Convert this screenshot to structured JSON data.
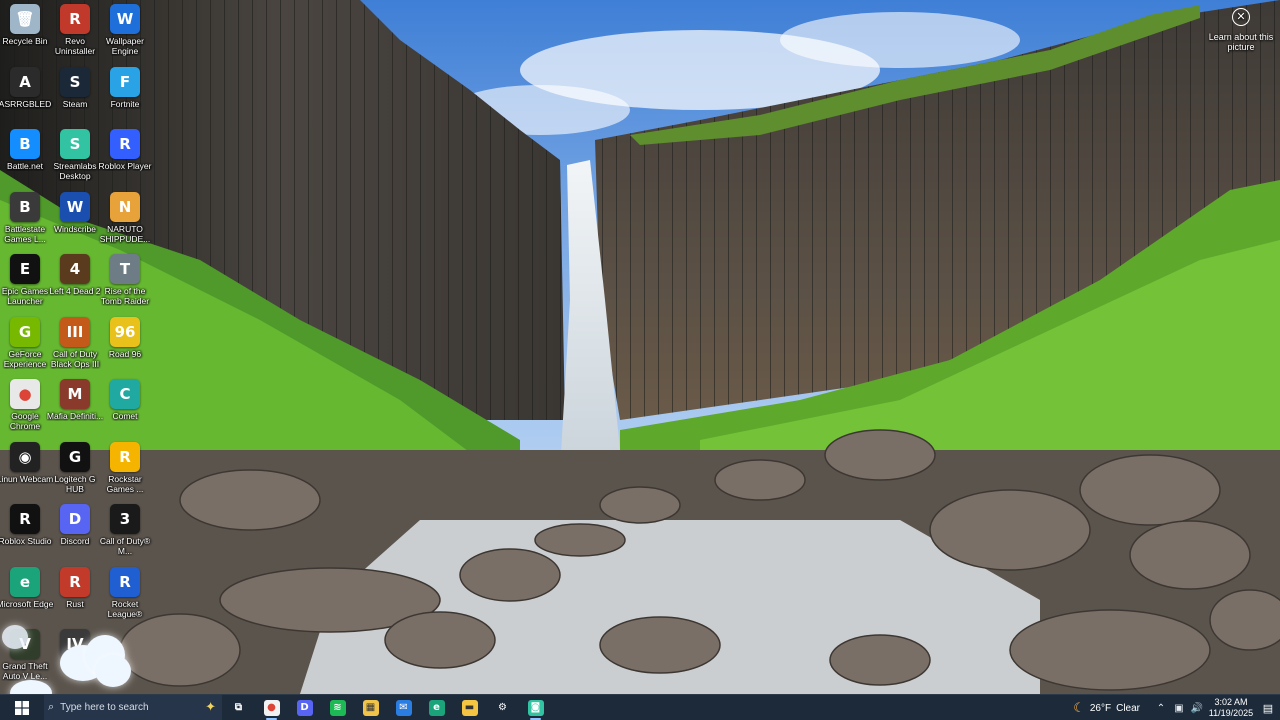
{
  "desktop": {
    "learn_label": "Learn about this picture",
    "icons": [
      {
        "label": "Recycle Bin",
        "icon": "recycle-bin-icon",
        "glyph": "🗑",
        "bg": "#9fb6c8"
      },
      {
        "label": "Revo Uninstaller",
        "icon": "revo-uninstaller-icon",
        "glyph": "R",
        "bg": "#c0392b"
      },
      {
        "label": "Wallpaper Engine",
        "icon": "wallpaper-engine-icon",
        "glyph": "W",
        "bg": "#1e6fd9"
      },
      {
        "label": "ASRRGBLED",
        "icon": "asrock-rgb-icon",
        "glyph": "A",
        "bg": "#2b2b2b"
      },
      {
        "label": "Steam",
        "icon": "steam-icon",
        "glyph": "S",
        "bg": "#1b2838"
      },
      {
        "label": "Fortnite",
        "icon": "fortnite-icon",
        "glyph": "F",
        "bg": "#2aa3e6"
      },
      {
        "label": "Battle.net",
        "icon": "battlenet-icon",
        "glyph": "B",
        "bg": "#148eff"
      },
      {
        "label": "Streamlabs Desktop",
        "icon": "streamlabs-icon",
        "glyph": "S",
        "bg": "#31c3a2"
      },
      {
        "label": "Roblox Player",
        "icon": "roblox-player-icon",
        "glyph": "R",
        "bg": "#335fff"
      },
      {
        "label": "Battlestate Games L...",
        "icon": "battlestate-icon",
        "glyph": "B",
        "bg": "#3a3a3a"
      },
      {
        "label": "Windscribe",
        "icon": "windscribe-icon",
        "glyph": "W",
        "bg": "#1a4fb0"
      },
      {
        "label": "NARUTO SHIPPUDE...",
        "icon": "naruto-icon",
        "glyph": "N",
        "bg": "#e8a23a"
      },
      {
        "label": "Epic Games Launcher",
        "icon": "epic-games-icon",
        "glyph": "E",
        "bg": "#111111"
      },
      {
        "label": "Left 4 Dead 2",
        "icon": "left4dead2-icon",
        "glyph": "4",
        "bg": "#5a3b1e"
      },
      {
        "label": "Rise of the Tomb Raider",
        "icon": "tomb-raider-icon",
        "glyph": "T",
        "bg": "#6e7c86"
      },
      {
        "label": "GeForce Experience",
        "icon": "geforce-icon",
        "glyph": "G",
        "bg": "#76b900"
      },
      {
        "label": "Call of Duty Black Ops III",
        "icon": "cod-bo3-icon",
        "glyph": "III",
        "bg": "#c45a1a"
      },
      {
        "label": "Road 96",
        "icon": "road96-icon",
        "glyph": "96",
        "bg": "#e8c21a"
      },
      {
        "label": "Google Chrome",
        "icon": "chrome-icon",
        "glyph": "●",
        "bg": "#e8e8e8"
      },
      {
        "label": "Mafia Definiti...",
        "icon": "mafia-icon",
        "glyph": "M",
        "bg": "#8a3a2a"
      },
      {
        "label": "Comet",
        "icon": "comet-icon",
        "glyph": "C",
        "bg": "#1fa9a0"
      },
      {
        "label": "Linun Webcam",
        "icon": "webcam-icon",
        "glyph": "◉",
        "bg": "#222222"
      },
      {
        "label": "Logitech G HUB",
        "icon": "logitech-ghub-icon",
        "glyph": "G",
        "bg": "#111111"
      },
      {
        "label": "Rockstar Games ...",
        "icon": "rockstar-icon",
        "glyph": "R",
        "bg": "#f5b400"
      },
      {
        "label": "Roblox Studio",
        "icon": "roblox-studio-icon",
        "glyph": "R",
        "bg": "#111111"
      },
      {
        "label": "Discord",
        "icon": "discord-icon",
        "glyph": "D",
        "bg": "#5865f2"
      },
      {
        "label": "Call of Duty® M...",
        "icon": "cod-mw-icon",
        "glyph": "3",
        "bg": "#1a1a1a"
      },
      {
        "label": "Microsoft Edge",
        "icon": "edge-icon",
        "glyph": "e",
        "bg": "#1ba37a"
      },
      {
        "label": "Rust",
        "icon": "rust-icon",
        "glyph": "R",
        "bg": "#c13a2a"
      },
      {
        "label": "Rocket League®",
        "icon": "rocket-league-icon",
        "glyph": "R",
        "bg": "#1f5fd1"
      },
      {
        "label": "Grand Theft Auto V Le...",
        "icon": "gta5-icon",
        "glyph": "V",
        "bg": "#2f3d2a"
      },
      {
        "label": "",
        "icon": "gta4-icon",
        "glyph": "IV",
        "bg": "#3a3a3a"
      }
    ]
  },
  "taskbar": {
    "search_placeholder": "Type here to search",
    "apps": [
      {
        "name": "task-view",
        "icon": "task-view-icon",
        "glyph": "⧉",
        "bg": "transparent",
        "active": false
      },
      {
        "name": "chrome",
        "icon": "chrome-icon",
        "glyph": "●",
        "bg": "#f2f2f2",
        "active": true
      },
      {
        "name": "discord",
        "icon": "discord-icon",
        "glyph": "D",
        "bg": "#5865f2",
        "active": false
      },
      {
        "name": "spotify",
        "icon": "spotify-icon",
        "glyph": "≋",
        "bg": "#1db954",
        "active": false
      },
      {
        "name": "store",
        "icon": "microsoft-store-icon",
        "glyph": "▦",
        "bg": "#f0c44a",
        "active": false
      },
      {
        "name": "mail",
        "icon": "mail-icon",
        "glyph": "✉",
        "bg": "#2a7de1",
        "active": false
      },
      {
        "name": "edge",
        "icon": "edge-icon",
        "glyph": "e",
        "bg": "#1ba37a",
        "active": false
      },
      {
        "name": "file-explorer",
        "icon": "folder-icon",
        "glyph": "▬",
        "bg": "#f4c542",
        "active": false
      },
      {
        "name": "settings",
        "icon": "gear-icon",
        "glyph": "⚙",
        "bg": "transparent",
        "active": false
      },
      {
        "name": "streamlabs",
        "icon": "streamlabs-icon",
        "glyph": "◙",
        "bg": "#31c3a2",
        "active": true
      }
    ],
    "weather": {
      "temp": "26°F",
      "condition": "Clear"
    },
    "clock": {
      "time": "3:02 AM",
      "date": "11/19/2025"
    }
  }
}
